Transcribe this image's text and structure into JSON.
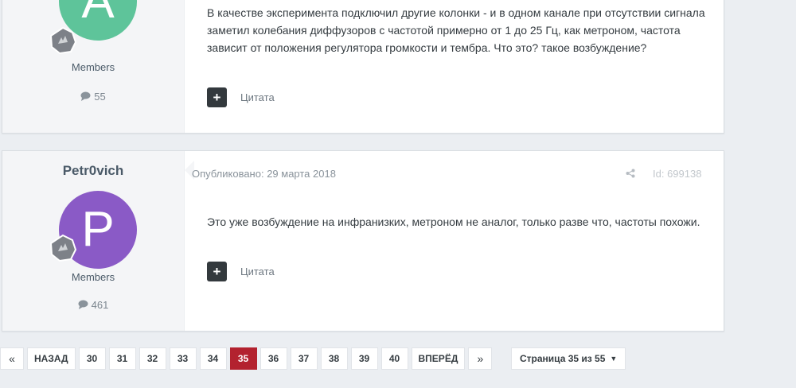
{
  "posts": [
    {
      "author_name": "",
      "avatar_letter": "A",
      "avatar_color": "#5ec49a",
      "group": "Members",
      "post_count": "55",
      "meta": "",
      "post_id": "",
      "body": "В качестве эксперимента подключил другие колонки - и в одном канале при отсутствии сигнала заметил колебания диффузоров с частотой примерно от 1 до 25 Гц, как метроном, частота зависит от положения регулятора громкости и тембра. Что это? такое возбуждение?",
      "plus_label": "+",
      "quote_label": "Цитата"
    },
    {
      "author_name": "Petr0vich",
      "avatar_letter": "P",
      "avatar_color": "#8a5ac6",
      "group": "Members",
      "post_count": "461",
      "meta": "Опубликовано: 29 марта 2018",
      "post_id": "Id: 699138",
      "body": "Это уже возбуждение на инфранизких, метроном не аналог, только разве что, частоты похожи.",
      "plus_label": "+",
      "quote_label": "Цитата"
    }
  ],
  "pagination": {
    "first": "«",
    "prev": "НАЗАД",
    "pages": [
      "30",
      "31",
      "32",
      "33",
      "34",
      "35",
      "36",
      "37",
      "38",
      "39",
      "40"
    ],
    "current": "35",
    "next": "ВПЕРЁД",
    "last": "»",
    "page_jump": "Страница 35 из 55"
  },
  "colors": {
    "accent": "#b3222f",
    "background": "#ebeef2"
  },
  "icons": {
    "rank": "rank-badge-icon",
    "comment": "comment-icon",
    "share": "share-icon",
    "caret": "caret-down-icon"
  }
}
